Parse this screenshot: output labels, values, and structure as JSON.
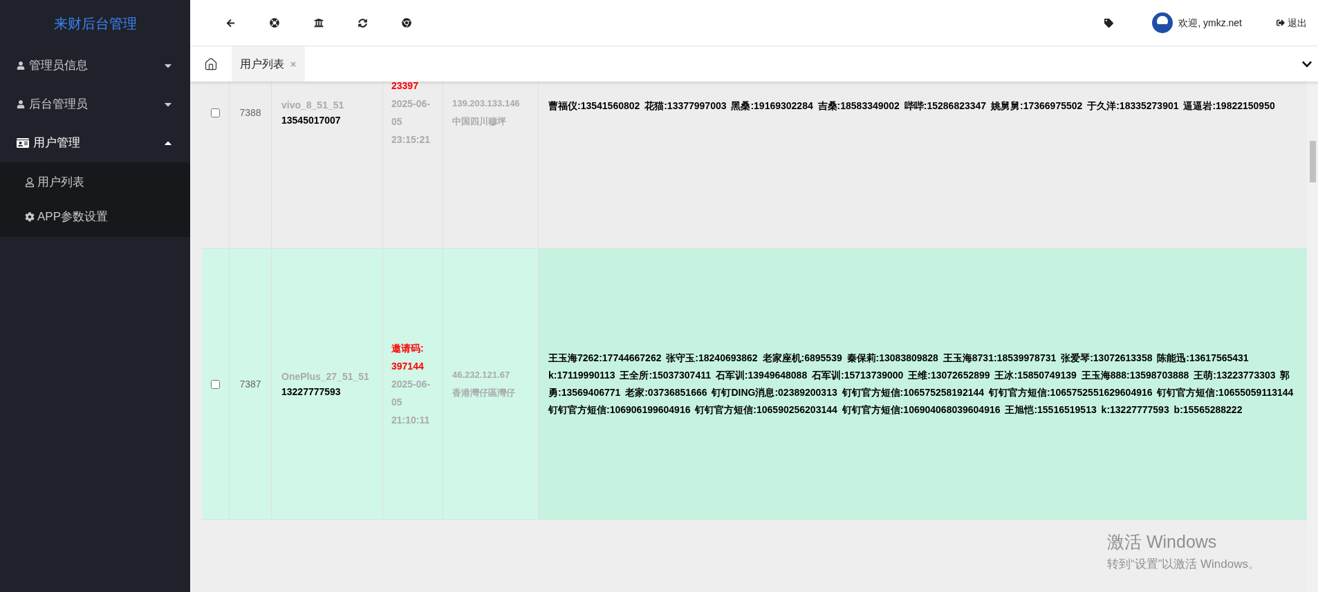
{
  "sidebar": {
    "title": "来财后台管理",
    "items": [
      {
        "label": "管理员信息",
        "kind": "person",
        "expanded": false
      },
      {
        "label": "后台管理员",
        "kind": "person",
        "expanded": false
      },
      {
        "label": "用户管理",
        "kind": "card",
        "expanded": true,
        "children": [
          {
            "label": "用户列表",
            "kind": "user"
          },
          {
            "label": "APP参数设置",
            "kind": "gear"
          }
        ]
      }
    ]
  },
  "topbar": {
    "welcome": "欢迎, ymkz.net",
    "logout": "退出"
  },
  "tabs": [
    {
      "label": "用户列表",
      "selected": true
    }
  ],
  "table": {
    "rows": [
      {
        "selected": false,
        "checked": false,
        "id": "7388",
        "device": "vivo_8_51_51",
        "phone": "13545017007",
        "invite_code": "23397",
        "time": "2025-06-05 23:15:21",
        "ip": "139.203.133.146",
        "location": "中国四川穆坪",
        "contacts": "曹福仪:13541560802 花猫:13377997003 黑桑:19169302284 吉桑:18583349002 哔哔:15286823347 姚舅舅:17366975502 于久洋:18335273901 逼逼岩:19822150950"
      },
      {
        "selected": true,
        "checked": false,
        "id": "7387",
        "device": "OnePlus_27_51_51",
        "phone": "13227777593",
        "invite_label": "邀请码:",
        "invite_code": "397144",
        "time": "2025-06-05 21:10:11",
        "ip": "46.232.121.67",
        "location": "香港灣仔區灣仔",
        "contacts": "王玉海7262:17744667262 张守玉:18240693862 老家座机:6895539 秦保莉:13083809828 王玉海8731:18539978731 张爱琴:13072613358 陈能迅:13617565431 k:17119990113 王全所:15037307411 石军训:13949648088 石军训:15713739000 王维:13072652899 王冰:15850749139 王玉海888:13598703888 王萌:13223773303 郭勇:13569406771 老家:03736851666 钉钉DING消息:02389200313 钉钉官方短信:106575258192144 钉钉官方短信:1065752551629604916 钉钉官方短信:10655059113144 钉钉官方短信:106906199604916 钉钉官方短信:106590256203144 钉钉官方短信:106904068039604916 王旭恺:15516519513 k:13227777593 b:15565288222"
      }
    ]
  },
  "os_notice": {
    "title": "激活 Windows",
    "subtitle": "转到“设置”以激活 Windows。"
  }
}
